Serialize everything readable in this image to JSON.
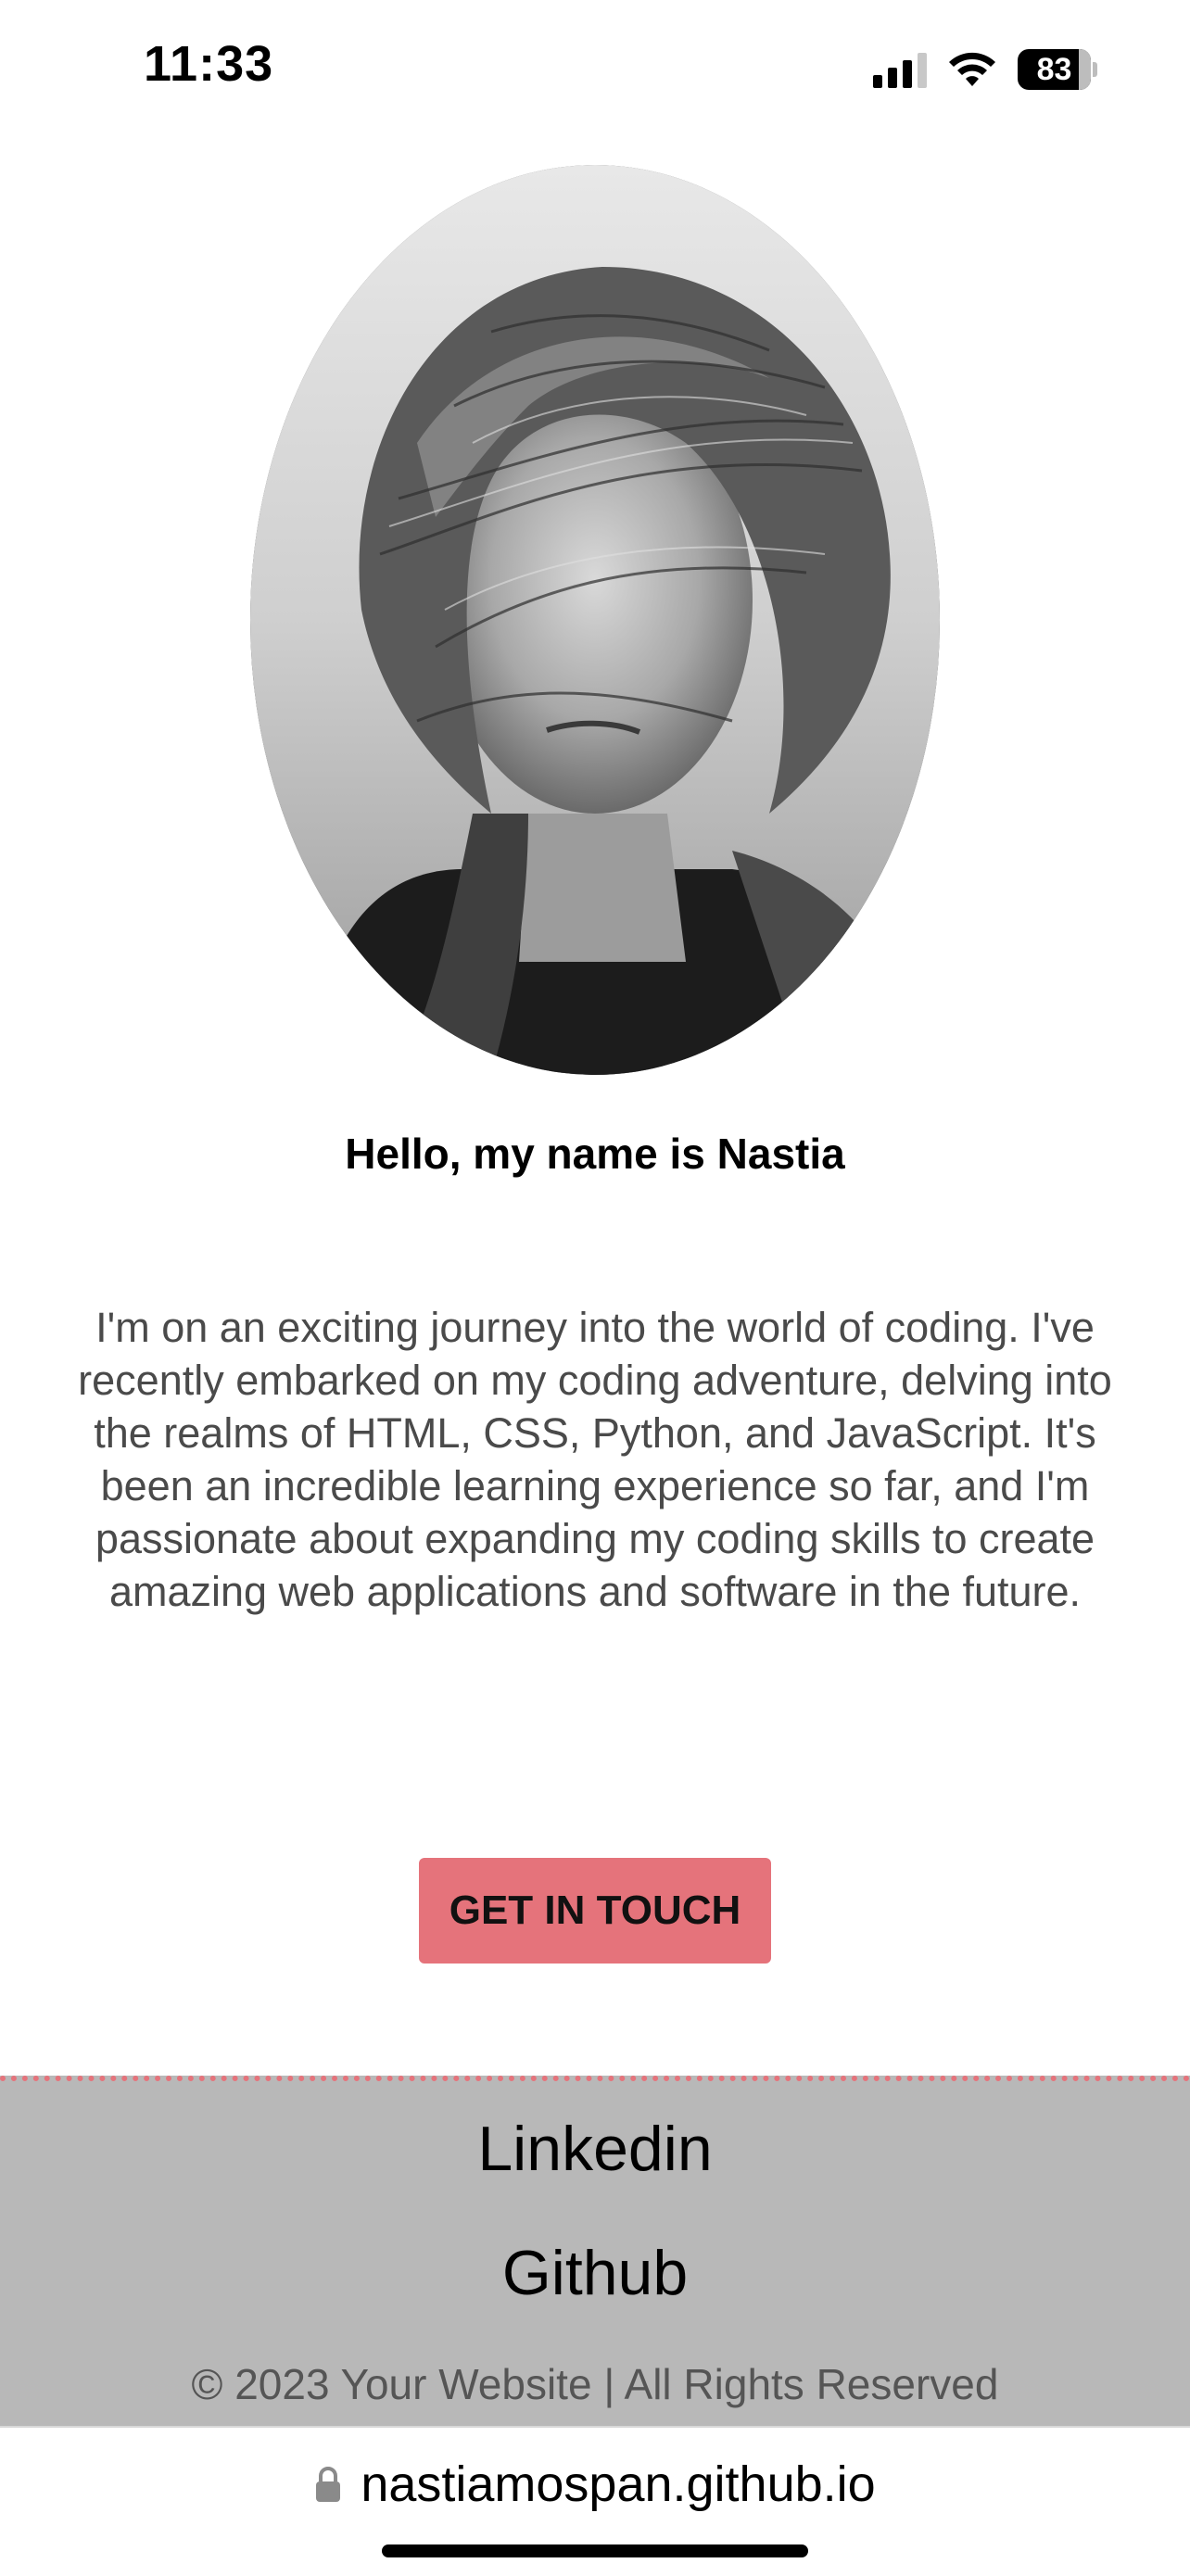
{
  "status_bar": {
    "time": "11:33",
    "battery_level": "83",
    "icons": [
      "signal-icon",
      "wifi-icon",
      "battery-icon"
    ]
  },
  "profile": {
    "photo": "portrait-photo",
    "greeting": "Hello, my name is Nastia",
    "intro": "I'm on an exciting journey into the world of coding. I've recently embarked on my coding adventure, delving into the realms of HTML, CSS, Python, and JavaScript. It's been an incredible learning experience so far, and I'm passionate about expanding my coding skills to create amazing web applications and software in the future."
  },
  "cta": {
    "label": "GET IN TOUCH"
  },
  "footer": {
    "linkedin_label": "Linkedin",
    "github_label": "Github",
    "copyright": "© 2023 Your Website | All Rights Reserved"
  },
  "browser": {
    "url": "nastiamospan.github.io"
  },
  "colors": {
    "accent": "#e5737b",
    "footer_bg": "#b8b8b8",
    "body_text": "#4a4a4a"
  }
}
